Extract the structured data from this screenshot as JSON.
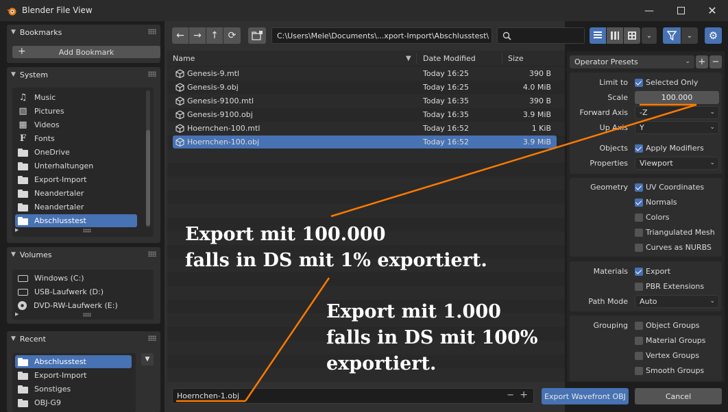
{
  "window": {
    "title": "Blender File View",
    "minimize_icon": "minimize-icon",
    "maximize_icon": "maximize-icon",
    "close_icon": "close-icon"
  },
  "sidebar": {
    "bookmarks": {
      "title": "Bookmarks",
      "add_label": "Add Bookmark"
    },
    "system": {
      "title": "System",
      "items": [
        {
          "label": "Music",
          "icon": "music-icon"
        },
        {
          "label": "Pictures",
          "icon": "picture-icon"
        },
        {
          "label": "Videos",
          "icon": "video-icon"
        },
        {
          "label": "Fonts",
          "icon": "font-icon"
        },
        {
          "label": "OneDrive",
          "icon": "folder-icon"
        },
        {
          "label": "Unterhaltungen",
          "icon": "folder-icon"
        },
        {
          "label": "Export-Import",
          "icon": "folder-icon"
        },
        {
          "label": "Neandertaler",
          "icon": "folder-icon"
        },
        {
          "label": "Neandertaler",
          "icon": "folder-icon"
        },
        {
          "label": "Abschlusstest",
          "icon": "folder-icon",
          "selected": true
        }
      ]
    },
    "volumes": {
      "title": "Volumes",
      "items": [
        {
          "label": "Windows (C:)",
          "icon": "drive-icon"
        },
        {
          "label": "USB-Laufwerk (D:)",
          "icon": "drive-icon"
        },
        {
          "label": "DVD-RW-Laufwerk (E:)",
          "icon": "disc-icon"
        }
      ]
    },
    "recent": {
      "title": "Recent",
      "items": [
        {
          "label": "Abschlusstest",
          "selected": true
        },
        {
          "label": "Export-Import"
        },
        {
          "label": "Sonstiges"
        },
        {
          "label": "OBJ-G9"
        }
      ]
    }
  },
  "toolbar": {
    "back_icon": "←",
    "forward_icon": "→",
    "parent_icon": "↑",
    "refresh_icon": "⟳",
    "path": "C:\\Users\\Mele\\Documents\\...xport-Import\\Abschlusstest\\",
    "search_placeholder": ""
  },
  "filelist": {
    "headers": {
      "name": "Name",
      "date": "Date Modified",
      "size": "Size"
    },
    "files": [
      {
        "name": "Genesis-9.mtl",
        "date": "Today 16:25",
        "size": "390 B"
      },
      {
        "name": "Genesis-9.obj",
        "date": "Today 16:25",
        "size": "4.0 MiB"
      },
      {
        "name": "Genesis-9100.mtl",
        "date": "Today 16:35",
        "size": "390 B"
      },
      {
        "name": "Genesis-9100.obj",
        "date": "Today 16:35",
        "size": "3.9 MiB"
      },
      {
        "name": "Hoernchen-100.mtl",
        "date": "Today 16:52",
        "size": "1 KiB"
      },
      {
        "name": "Hoernchen-100.obj",
        "date": "Today 16:52",
        "size": "3.9 MiB",
        "selected": true
      }
    ]
  },
  "footer": {
    "filename": "Hoernchen-1.obj",
    "minus": "−",
    "plus": "+",
    "export_label": "Export Wavefront OBJ",
    "cancel_label": "Cancel"
  },
  "options": {
    "presets_label": "Operator Presets",
    "limit_to_label": "Limit to",
    "selected_only": "Selected Only",
    "scale_label": "Scale",
    "scale_value": "100.000",
    "forward_axis_label": "Forward Axis",
    "forward_axis_value": "-Z",
    "up_axis_label": "Up Axis",
    "up_axis_value": "Y",
    "objects_label": "Objects",
    "apply_modifiers": "Apply Modifiers",
    "properties_label": "Properties",
    "properties_value": "Viewport",
    "geometry_label": "Geometry",
    "uv_coordinates": "UV Coordinates",
    "normals": "Normals",
    "colors": "Colors",
    "triangulated_mesh": "Triangulated Mesh",
    "curves_as_nurbs": "Curves as NURBS",
    "materials_label": "Materials",
    "export": "Export",
    "pbr_extensions": "PBR Extensions",
    "path_mode_label": "Path Mode",
    "path_mode_value": "Auto",
    "grouping_label": "Grouping",
    "object_groups": "Object Groups",
    "material_groups": "Material Groups",
    "vertex_groups": "Vertex Groups",
    "smooth_groups": "Smooth Groups"
  },
  "annotations": {
    "note1_line1": "Export mit 100.000",
    "note1_line2": "falls in DS mit 1% exportiert.",
    "note2_line1": "Export mit 1.000",
    "note2_line2": "falls in DS mit 100%",
    "note2_line3": "exportiert.",
    "color": "#ff7a00"
  },
  "colors": {
    "accent": "#4772b3",
    "annotation": "#ff7a00"
  }
}
